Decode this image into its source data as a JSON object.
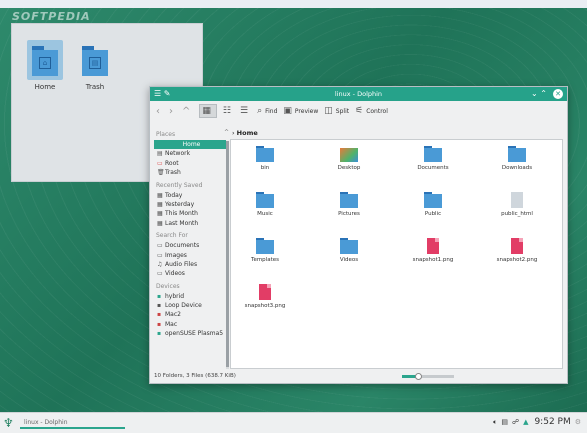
{
  "watermark": "SOFTPEDIA",
  "desktop": {
    "items": [
      {
        "label": "Home",
        "icon": "home-folder-icon"
      },
      {
        "label": "Trash",
        "icon": "trash-icon"
      }
    ]
  },
  "window": {
    "title": "linux - Dolphin",
    "toolbar": {
      "find": "Find",
      "preview": "Preview",
      "split": "Split",
      "control": "Control"
    },
    "sidebar": {
      "places_header": "Places",
      "places": [
        {
          "label": "Home",
          "icon": "home-icon"
        },
        {
          "label": "Network",
          "icon": "network-icon"
        },
        {
          "label": "Root",
          "icon": "folder-icon"
        },
        {
          "label": "Trash",
          "icon": "trash-icon"
        }
      ],
      "recent_header": "Recently Saved",
      "recent": [
        "Today",
        "Yesterday",
        "This Month",
        "Last Month"
      ],
      "search_header": "Search For",
      "search": [
        "Documents",
        "Images",
        "Audio Files",
        "Videos"
      ],
      "devices_header": "Devices",
      "devices": [
        "hybrid",
        "Loop Device",
        "Mac2",
        "Mac",
        "openSUSE Plasma5"
      ]
    },
    "breadcrumb": "Home",
    "files": [
      {
        "name": "bin",
        "type": "folder"
      },
      {
        "name": "Desktop",
        "type": "desktop"
      },
      {
        "name": "Documents",
        "type": "folder"
      },
      {
        "name": "Downloads",
        "type": "folder"
      },
      {
        "name": "Music",
        "type": "folder"
      },
      {
        "name": "Pictures",
        "type": "folder"
      },
      {
        "name": "Public",
        "type": "folder"
      },
      {
        "name": "public_html",
        "type": "html"
      },
      {
        "name": "Templates",
        "type": "folder"
      },
      {
        "name": "Videos",
        "type": "folder"
      },
      {
        "name": "snapshot1.png",
        "type": "png"
      },
      {
        "name": "snapshot2.png",
        "type": "png"
      },
      {
        "name": "snapshot3.png",
        "type": "png"
      }
    ],
    "status": "10 Folders, 3 Files (638.7 KiB)",
    "zoom_level": 0.3
  },
  "taskbar": {
    "task_label": "linux - Dolphin",
    "clock": "9:52 PM"
  },
  "colors": {
    "accent": "#2ba58d",
    "titlebar": "#26a28a",
    "folder": "#4a9ad6"
  }
}
